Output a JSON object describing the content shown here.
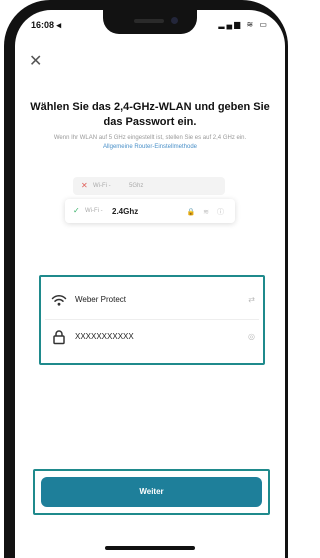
{
  "status_bar": {
    "time": "16:08 ◂",
    "icons": "▂▄▆ ≋ ▭"
  },
  "header": {
    "close_icon": "✕"
  },
  "content": {
    "title": "Wählen Sie das 2,4-GHz-WLAN und geben Sie das Passwort ein.",
    "subtitle": "Wenn Ihr WLAN auf 5 GHz eingestellt ist, stellen Sie es auf 2,4 GHz ein.",
    "subtitle_link": "Allgemeine Router-Einstellmethode"
  },
  "illustration": {
    "row1_label": "Wi-Fi -",
    "row1_freq": "5Ghz",
    "row2_label": "Wi-Fi -",
    "row2_freq": "2.4Ghz",
    "row2_icons": "🔒 ≋ ⓘ"
  },
  "form": {
    "wifi_name": "Weber Protect",
    "wifi_trail": "⇄",
    "password": "XXXXXXXXXXX",
    "password_trail": "◎"
  },
  "footer": {
    "next_label": "Weiter"
  },
  "colors": {
    "accent": "#1e7f9a",
    "highlight_border": "#1f8a8c"
  }
}
